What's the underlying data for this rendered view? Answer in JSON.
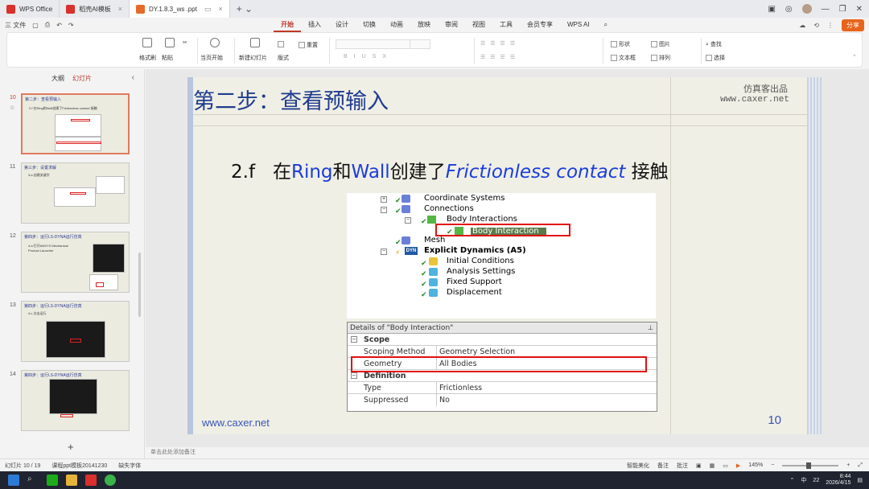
{
  "titlebar": {
    "tabs": [
      {
        "label": "WPS Office"
      },
      {
        "label": "稻壳AI模板"
      },
      {
        "label": "DY.1.8.3_ws .ppt"
      }
    ]
  },
  "menubar": {
    "file_label": "三 文件",
    "tabs": [
      "开始",
      "插入",
      "设计",
      "切换",
      "动画",
      "放映",
      "审阅",
      "视图",
      "工具",
      "会员专享",
      "WPS AI"
    ],
    "share_label": "分享"
  },
  "ribbon": {
    "format_painter": "格式刷",
    "paste": "粘贴",
    "play_from_current": "当页开始",
    "new_slide": "新建幻灯片",
    "layout": "版式",
    "reset": "重置",
    "shape": "形状",
    "picture": "图片",
    "textbox": "文本框",
    "arrange": "排列",
    "find": "查找",
    "select": "选择"
  },
  "leftpanel": {
    "tab_outline": "大纲",
    "tab_slides": "幻灯片",
    "slides": [
      {
        "num": "10",
        "title": "第二步：查看预输入",
        "line": "2.f 在Ring和Wall创建了Frictionless contact 接触"
      },
      {
        "num": "11",
        "title": "第三步：设置求解",
        "line": "3.a 创建关键字"
      },
      {
        "num": "12",
        "title": "第四步：运行LS-DYNA运行仿真",
        "line": "4.a 打开ANSYS Mechanical Product Launcher"
      },
      {
        "num": "13",
        "title": "第四步：运行LS-DYNA运行仿真",
        "line": "4.c 点击运行"
      },
      {
        "num": "14",
        "title": "第四步：运行LS-DYNA运行仿真",
        "line": ""
      }
    ]
  },
  "slide": {
    "title": "第二步：查看预输入",
    "brand": "仿真客出品",
    "brand_url": "www.caxer.net",
    "sub_num": "2.f",
    "sub_zai": "在",
    "sub_ring": "Ring",
    "sub_he": "和",
    "sub_wall": "Wall",
    "sub_created": "创建了",
    "sub_contact": "Frictionless contact",
    "sub_tail": " 接触",
    "footer_url": "www.caxer.net",
    "page_num": "10",
    "tree": {
      "coordinate_systems": "Coordinate Systems",
      "connections": "Connections",
      "body_interactions": "Body Interactions",
      "body_interaction": "Body Interaction",
      "mesh": "Mesh",
      "explicit_dynamics": "Explicit Dynamics (A5)",
      "dyn_badge": "DYN",
      "initial_conditions": "Initial Conditions",
      "analysis_settings": "Analysis Settings",
      "fixed_support": "Fixed Support",
      "displacement": "Displacement"
    },
    "details": {
      "title": "Details of \"Body Interaction\"",
      "scope": "Scope",
      "scoping_method_k": "Scoping Method",
      "scoping_method_v": "Geometry Selection",
      "geometry_k": "Geometry",
      "geometry_v": "All Bodies",
      "definition": "Definition",
      "type_k": "Type",
      "type_v": "Frictionless",
      "suppressed_k": "Suppressed",
      "suppressed_v": "No"
    }
  },
  "notes_placeholder": "单击此处添加备注",
  "statusbar": {
    "slide_info": "幻灯片 10 / 19",
    "template": "课程ppt模板20141230",
    "missing_font": "缺失字体",
    "beautify": "智能美化",
    "notes": "备注",
    "comments": "批注",
    "zoom": "145%"
  },
  "taskbar": {
    "time": "8:44",
    "date": "2026/4/15",
    "lang": "中",
    "notif": "22"
  },
  "colors": {
    "accent": "#c0392b",
    "slide_title": "#1f3c8f",
    "highlight_red": "#e30f0f"
  }
}
